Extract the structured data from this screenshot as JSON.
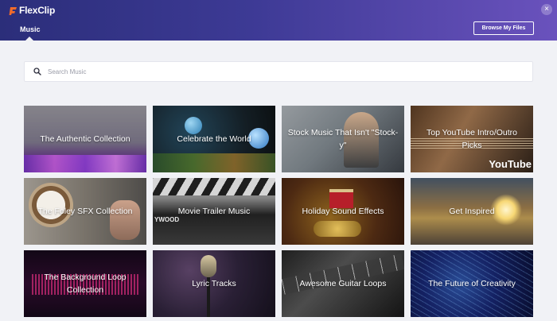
{
  "app": {
    "logo_text": "FlexClip",
    "close_symbol": "×"
  },
  "header": {
    "tab_music": "Music",
    "browse_button": "Browse My Files"
  },
  "search": {
    "placeholder": "Search Music",
    "value": ""
  },
  "cards": [
    {
      "label": "The Authentic Collection"
    },
    {
      "label": "Celebrate the World"
    },
    {
      "label": "Stock Music That Isn't \"Stock-y\""
    },
    {
      "label": "Top YouTube Intro/Outro Picks"
    },
    {
      "label": "The Foley SFX Collection"
    },
    {
      "label": "Movie Trailer Music"
    },
    {
      "label": "Holiday Sound Effects"
    },
    {
      "label": "Get Inspired"
    },
    {
      "label": "The Background Loop Collection"
    },
    {
      "label": "Lyric Tracks"
    },
    {
      "label": "Awesome Guitar Loops"
    },
    {
      "label": "The Future of Creativity"
    }
  ],
  "decor_text": {
    "youtube_logo": "YouTube",
    "clapper_text": "YWOOD"
  },
  "colors": {
    "header_start": "#2b2e7a",
    "header_end": "#6a52bd",
    "logo_accent": "#f26b2a",
    "page_bg": "#f1f2f6"
  }
}
